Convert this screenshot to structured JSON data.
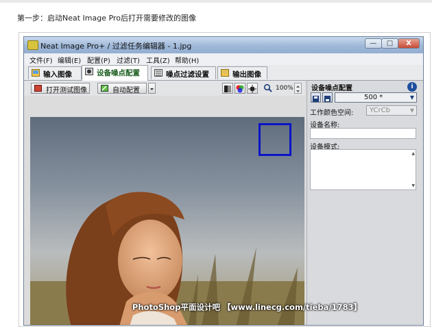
{
  "caption": "第一步：启动Neat Image Pro后打开需要修改的图像",
  "window": {
    "title": "Neat Image Pro+ / 过滤任务编辑器 - 1.jpg",
    "buttons": {
      "minimize": "—",
      "maximize": "□",
      "close": "X"
    }
  },
  "menu": [
    "文件(F)",
    "编辑(E)",
    "配置(P)",
    "过滤(T)",
    "工具(Z)",
    "帮助(H)"
  ],
  "tabs": [
    {
      "label": "输入图像",
      "icon": "input-image-icon"
    },
    {
      "label": "设备噪点配置",
      "icon": "device-profile-icon"
    },
    {
      "label": "噪点过滤设置",
      "icon": "filter-settings-icon"
    },
    {
      "label": "输出图像",
      "icon": "output-image-icon"
    }
  ],
  "toolbar": {
    "open_test_image": "打开测试图像",
    "auto_profile": "自动配置",
    "zoom": "100%"
  },
  "panel": {
    "title": "设备噪点配置",
    "profile_value": "500 *",
    "color_space_label": "工作颜色空间:",
    "color_space_value": "YCrCb",
    "device_name_label": "设备名称:",
    "device_name_value": "",
    "device_mode_label": "设备模式:",
    "device_mode_value": ""
  },
  "watermark": "PhotoShop平面设计吧 【www.linecg.com/tieba/1783】",
  "colors": {
    "selection_box": "#0a14c8",
    "titlebar": "#9fb8d8",
    "close_button": "#c74a35"
  }
}
